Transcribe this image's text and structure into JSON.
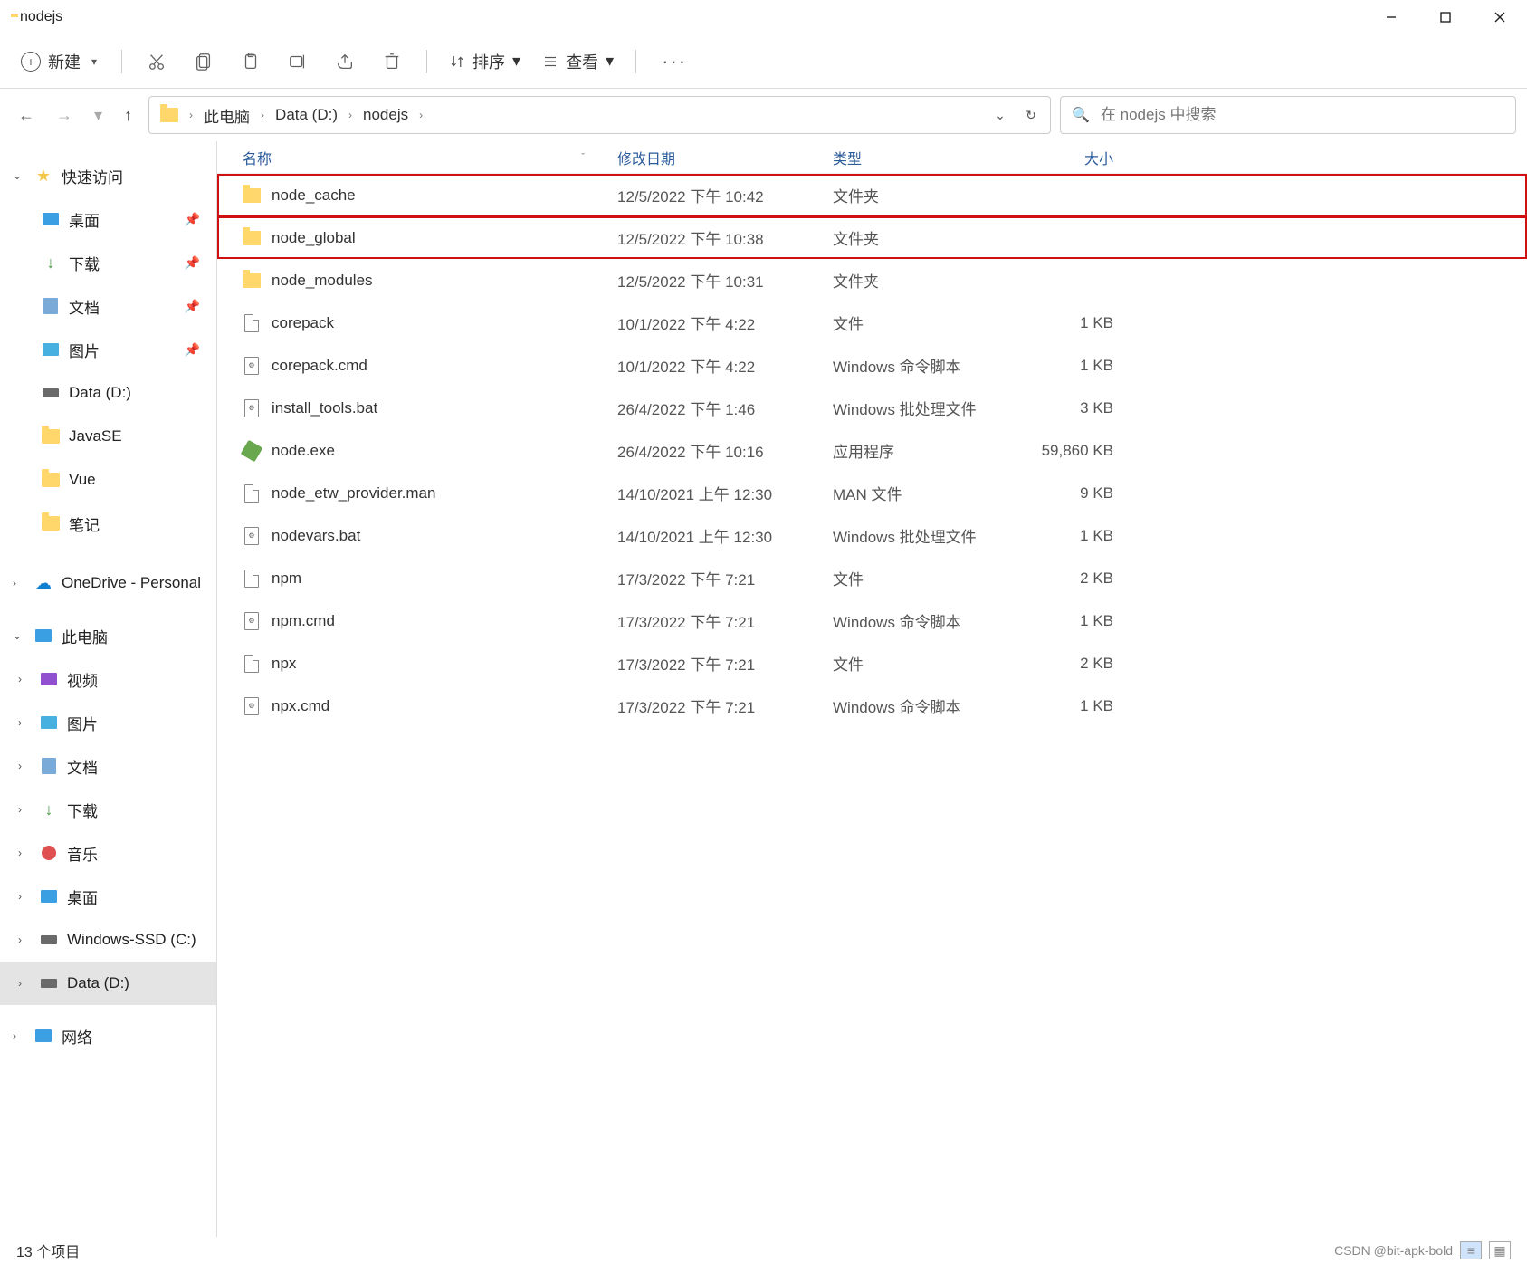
{
  "titlebar": {
    "title": "nodejs"
  },
  "toolbar": {
    "new_label": "新建",
    "sort_label": "排序",
    "view_label": "查看"
  },
  "breadcrumb": {
    "seg0": "此电脑",
    "seg1": "Data (D:)",
    "seg2": "nodejs"
  },
  "search": {
    "placeholder": "在 nodejs 中搜索"
  },
  "columns": {
    "name": "名称",
    "date": "修改日期",
    "type": "类型",
    "size": "大小"
  },
  "sidebar": {
    "quick": "快速访问",
    "desktop": "桌面",
    "downloads": "下载",
    "documents": "文档",
    "pictures": "图片",
    "datad": "Data (D:)",
    "javase": "JavaSE",
    "vue": "Vue",
    "notes": "笔记",
    "onedrive": "OneDrive - Personal",
    "thispc": "此电脑",
    "videos": "视频",
    "pictures2": "图片",
    "documents2": "文档",
    "downloads2": "下载",
    "music": "音乐",
    "desktop2": "桌面",
    "winssd": "Windows-SSD (C:)",
    "datad2": "Data (D:)",
    "network": "网络"
  },
  "files": [
    {
      "name": "node_cache",
      "date": "12/5/2022 下午 10:42",
      "type": "文件夹",
      "size": "",
      "icon": "folder",
      "hl": true
    },
    {
      "name": "node_global",
      "date": "12/5/2022 下午 10:38",
      "type": "文件夹",
      "size": "",
      "icon": "folder",
      "hl": true
    },
    {
      "name": "node_modules",
      "date": "12/5/2022 下午 10:31",
      "type": "文件夹",
      "size": "",
      "icon": "folder"
    },
    {
      "name": "corepack",
      "date": "10/1/2022 下午 4:22",
      "type": "文件",
      "size": "1 KB",
      "icon": "file"
    },
    {
      "name": "corepack.cmd",
      "date": "10/1/2022 下午 4:22",
      "type": "Windows 命令脚本",
      "size": "1 KB",
      "icon": "cmd"
    },
    {
      "name": "install_tools.bat",
      "date": "26/4/2022 下午 1:46",
      "type": "Windows 批处理文件",
      "size": "3 KB",
      "icon": "cmd"
    },
    {
      "name": "node.exe",
      "date": "26/4/2022 下午 10:16",
      "type": "应用程序",
      "size": "59,860 KB",
      "icon": "exe"
    },
    {
      "name": "node_etw_provider.man",
      "date": "14/10/2021 上午 12:30",
      "type": "MAN 文件",
      "size": "9 KB",
      "icon": "file"
    },
    {
      "name": "nodevars.bat",
      "date": "14/10/2021 上午 12:30",
      "type": "Windows 批处理文件",
      "size": "1 KB",
      "icon": "cmd"
    },
    {
      "name": "npm",
      "date": "17/3/2022 下午 7:21",
      "type": "文件",
      "size": "2 KB",
      "icon": "file"
    },
    {
      "name": "npm.cmd",
      "date": "17/3/2022 下午 7:21",
      "type": "Windows 命令脚本",
      "size": "1 KB",
      "icon": "cmd"
    },
    {
      "name": "npx",
      "date": "17/3/2022 下午 7:21",
      "type": "文件",
      "size": "2 KB",
      "icon": "file"
    },
    {
      "name": "npx.cmd",
      "date": "17/3/2022 下午 7:21",
      "type": "Windows 命令脚本",
      "size": "1 KB",
      "icon": "cmd"
    }
  ],
  "status": {
    "count": "13 个项目",
    "watermark": "CSDN @bit-apk-bold"
  }
}
